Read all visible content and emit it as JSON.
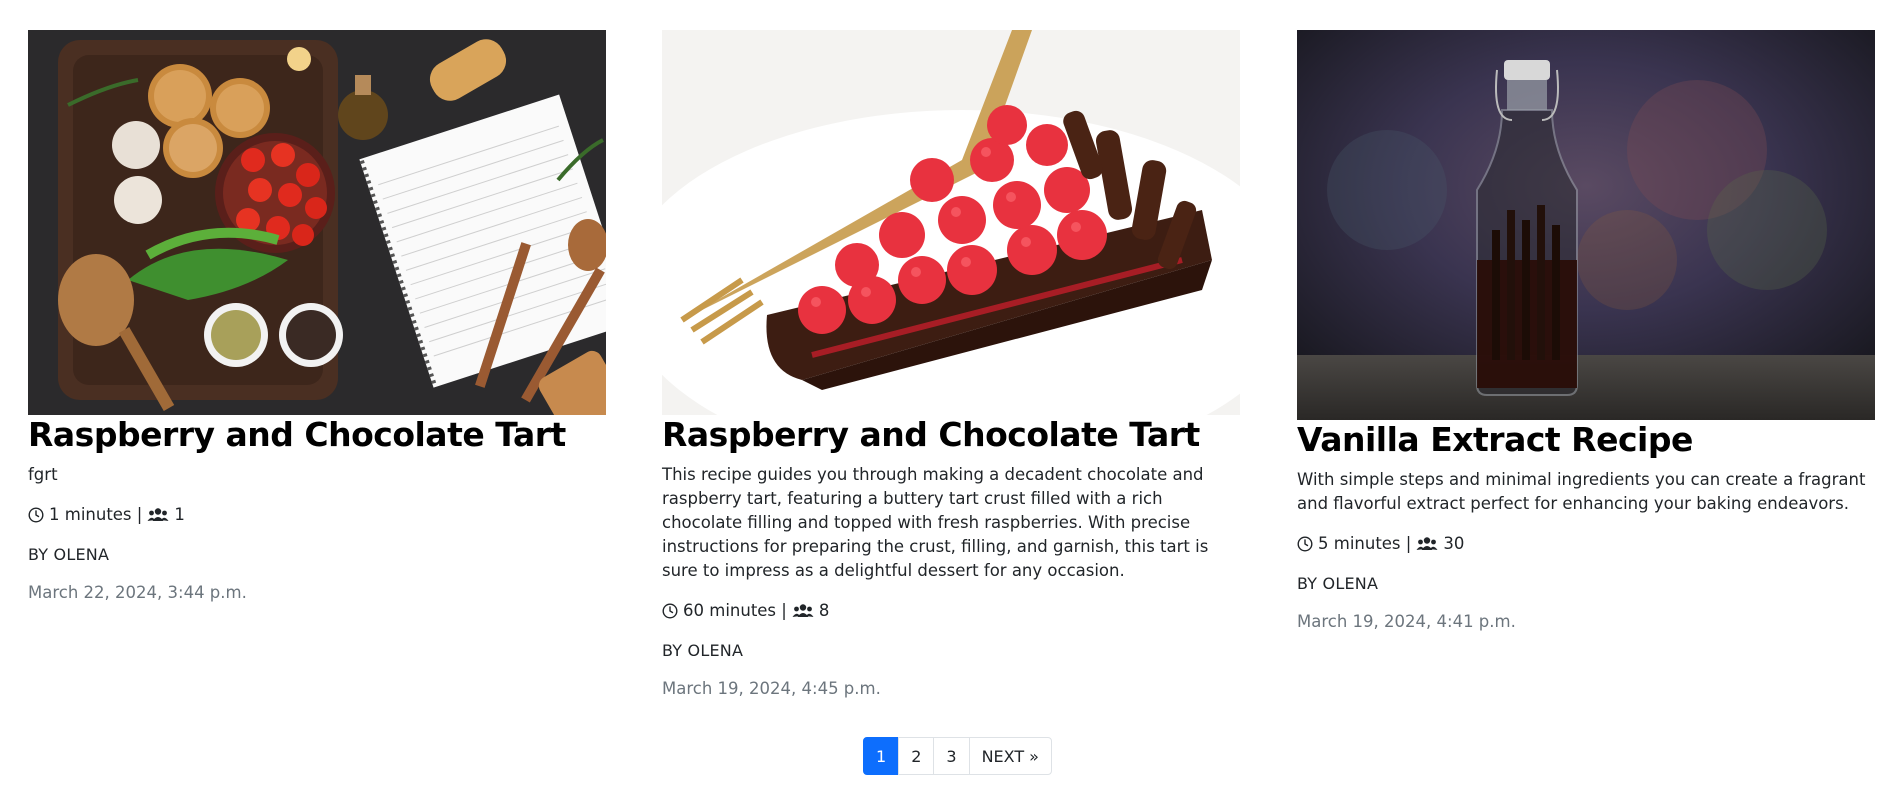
{
  "cards": [
    {
      "image": "recipe-photo-cooking-ingredients",
      "title": "Raspberry and Chocolate Tart",
      "description": "fgrt",
      "minutes": "1 minutes |",
      "servings": "1",
      "author": "BY OLENA",
      "date": "March 22, 2024, 3:44 p.m."
    },
    {
      "image": "recipe-photo-raspberry-tart",
      "title": "Raspberry and Chocolate Tart",
      "description": "This recipe guides you through making a decadent chocolate and raspberry tart, featuring a buttery tart crust filled with a rich chocolate filling and topped with fresh raspberries. With precise instructions for preparing the crust, filling, and garnish, this tart is sure to impress as a delightful dessert for any occasion.",
      "minutes": "60 minutes |",
      "servings": "8",
      "author": "BY OLENA",
      "date": "March 19, 2024, 4:45 p.m."
    },
    {
      "image": "recipe-photo-vanilla-bottle",
      "title": "Vanilla Extract Recipe",
      "description": "With simple steps and minimal ingredients you can create a fragrant and flavorful extract perfect for enhancing your baking endeavors.",
      "minutes": "5 minutes |",
      "servings": "30",
      "author": "BY OLENA",
      "date": "March 19, 2024, 4:41 p.m."
    }
  ],
  "pagination": {
    "pages": [
      "1",
      "2",
      "3"
    ],
    "active_page": "1",
    "next_label": "NEXT »"
  },
  "colors": {
    "accent": "#0d6efd",
    "muted": "#6c757d"
  }
}
